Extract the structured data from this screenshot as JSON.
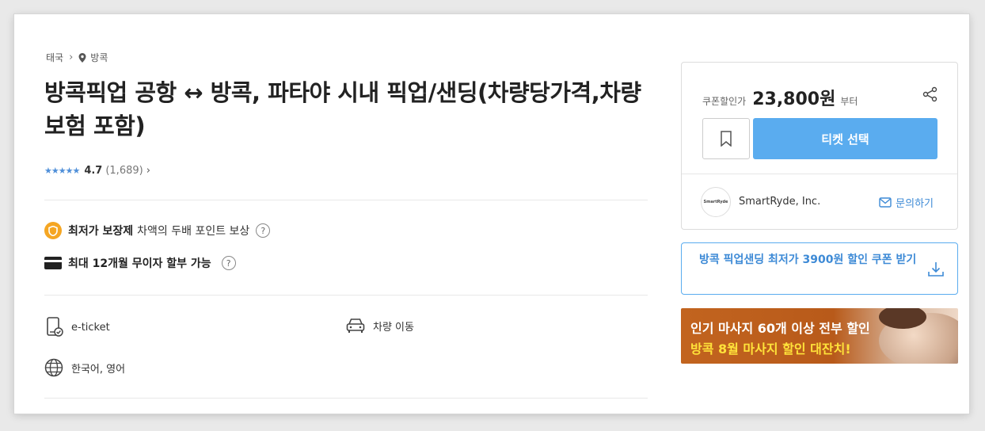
{
  "breadcrumb": {
    "country": "태국",
    "city": "방콕"
  },
  "title": "방콕픽업 공항 ↔ 방콕, 파타야 시내 픽업/샌딩(차량당가격,차량보험 포함)",
  "rating": {
    "stars": "★★★★★",
    "score": "4.7",
    "count": "(1,689)",
    "arrow": "›"
  },
  "benefits": {
    "guarantee_label": "최저가 보장제",
    "guarantee_desc": "차액의 두배 포인트 보상",
    "installment_label": "최대 12개월 무이자 할부 가능",
    "help_glyph": "?"
  },
  "info": {
    "ticket": "e-ticket",
    "transport": "차량 이동",
    "language": "한국어, 영어"
  },
  "price_box": {
    "label": "쿠폰할인가",
    "price": "23,800원",
    "suffix": "부터",
    "ticket_button": "티켓 선택",
    "seller_logo_text": "SmartRyde",
    "seller_name": "SmartRyde, Inc.",
    "contact": "문의하기"
  },
  "coupon": {
    "text": "방콕 픽업샌딩 최저가 3900원 할인 쿠폰 받기"
  },
  "banner": {
    "line1": "인기 마사지 60개 이상 전부 할인",
    "line2": "방콕 8월 마사지 할인 대잔치!"
  },
  "colors": {
    "accent": "#5aacef",
    "link": "#3d8ad6",
    "badge": "#f5a623",
    "star": "#4f8fd9"
  },
  "icons": [
    "chevron-right-icon",
    "pin-icon",
    "shield-icon",
    "card-icon",
    "help-icon",
    "ticket-icon",
    "car-icon",
    "globe-icon",
    "share-icon",
    "bookmark-icon",
    "mail-icon",
    "download-icon"
  ]
}
